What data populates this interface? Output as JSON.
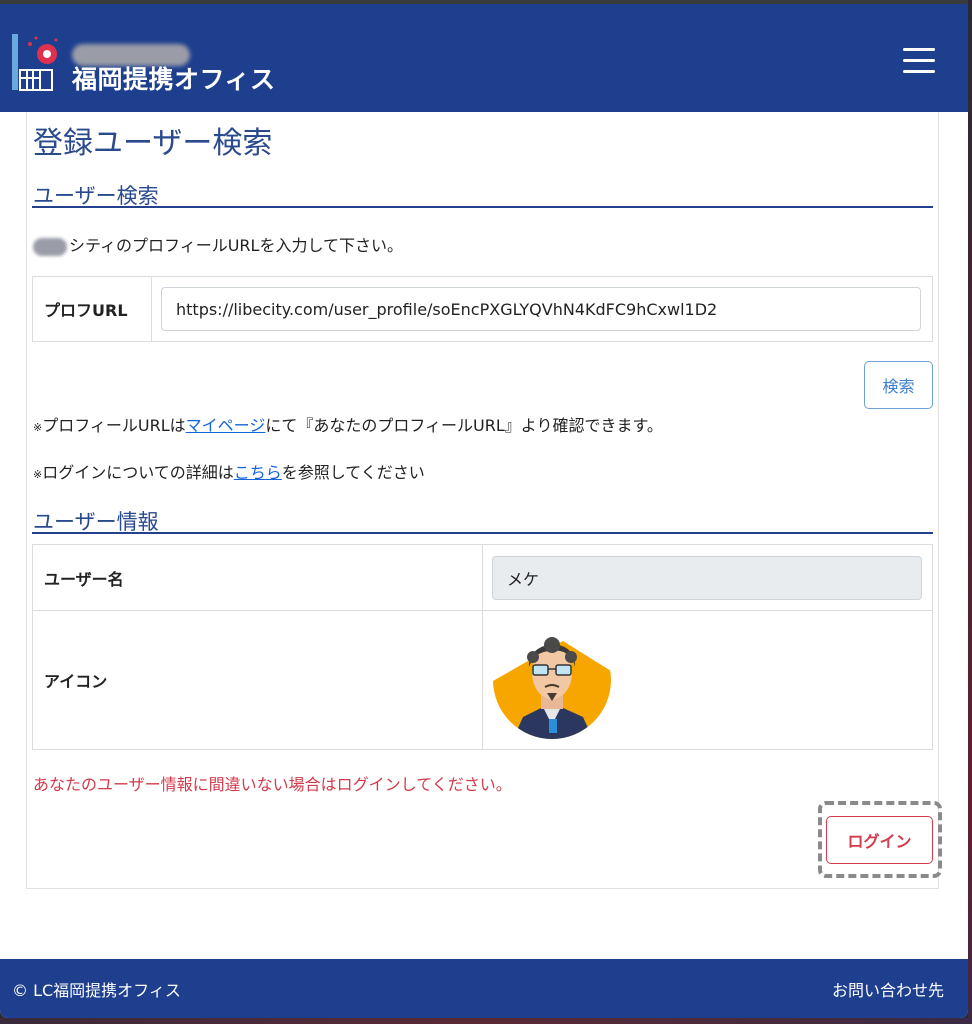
{
  "header": {
    "brand": "福岡提携オフィス",
    "menu_icon": "hamburger-menu-icon",
    "color": "#1e3f8e"
  },
  "page": {
    "title": "登録ユーザー検索"
  },
  "search_section": {
    "heading": "ユーザー検索",
    "instruction": "シティのプロフィールURLを入力して下さい。",
    "url_label": "プロフURL",
    "url_value": "https://libecity.com/user_profile/soEncPXGLYQVhN4KdFC9hCxwl1D2",
    "search_button": "検索",
    "note1_mark": "※",
    "note1_pre": "プロフィールURLは",
    "note1_link": "マイページ",
    "note1_post": "にて『あなたのプロフィールURL』より確認できます。",
    "note2_mark": "※",
    "note2_pre": "ログインについての詳細は",
    "note2_link": "こちら",
    "note2_post": "を参照してください"
  },
  "user_info": {
    "heading": "ユーザー情報",
    "username_label": "ユーザー名",
    "username_value": "メケ",
    "icon_label": "アイコン",
    "warning": "あなたのユーザー情報に間違いない場合はログインしてください。",
    "login_button": "ログイン",
    "warning_color": "#d33a4c"
  },
  "footer": {
    "copyright": "© LC福岡提携オフィス",
    "contact": "お問い合わせ先"
  }
}
